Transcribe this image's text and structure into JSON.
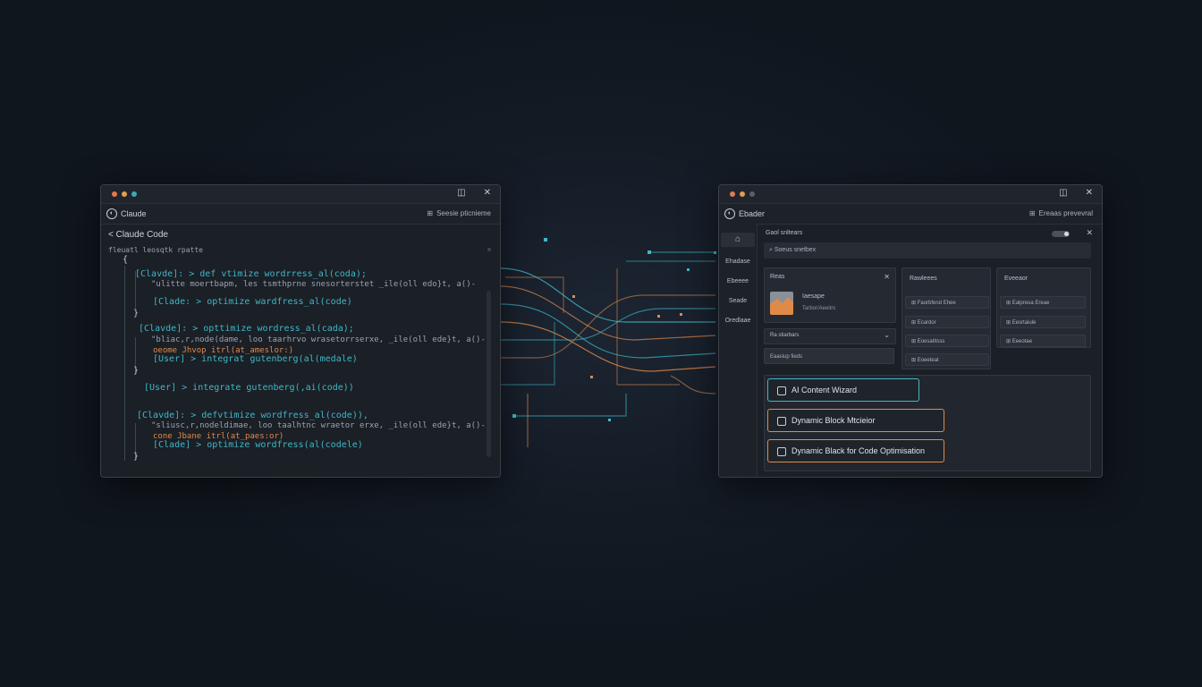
{
  "colors": {
    "teal": "#3fb8c8",
    "orange": "#e08a4a",
    "green": "#7fc7a8",
    "text": "#c8ced8",
    "dot_red": "#e07b4f",
    "dot_orange": "#e0a04f",
    "dot_teal": "#3fa8b8",
    "dot_gray": "#5a606a"
  },
  "left_window": {
    "title": "Claude",
    "header_action": "Seesie pticnieme",
    "breadcrumb": "< Claude Code",
    "file_label": "fleuatl leosqtk rpatte",
    "code_lines": [
      {
        "text": "{",
        "color": "#c8ced8"
      },
      {
        "text": "[Clavde]: > def vtimize wordrress_al(coda);",
        "color": "#3fb8c8"
      },
      {
        "text": "\"ulitte moertbapm, les tsmthprne snesorterstet _ile(oll edo}t, a()-",
        "color": "#9aa3b0"
      },
      {
        "text": "[Clade: > optimize wardfress_al(code)",
        "color": "#3fb8c8"
      },
      {
        "text": "}",
        "color": "#c8ced8"
      },
      {
        "text": "[Clavde]: > opttimize wordress_al(cada);",
        "color": "#3fb8c8"
      },
      {
        "text": "\"bliac,r,node(dame, loo taarhrvo wrasetorrserxe, _ile(oll ede}t, a()-",
        "color": "#9aa3b0"
      },
      {
        "text": "oeome Jhvop itrl(at_ameslor:)",
        "color": "#e08a4a"
      },
      {
        "text": "[User] > integrat gutenberg(al(medale)",
        "color": "#3fb8c8"
      },
      {
        "text": "}",
        "color": "#c8ced8"
      },
      {
        "text": "[User] > integrate gutenberg(,ai(code))",
        "color": "#3fb8c8"
      },
      {
        "text": "[Clavde]: > defvtimize wordfress_al(code)),",
        "color": "#3fb8c8"
      },
      {
        "text": "\"sliusc,r,nodeldimae, loo taalhtnc wraetor erxe, _ile(oll ede}t, a()-",
        "color": "#9aa3b0"
      },
      {
        "text": "cone Jbane itrl(at_paes:or)",
        "color": "#e08a4a"
      },
      {
        "text": "[Clade] > optimize wordfress(al(codele)",
        "color": "#3fb8c8"
      },
      {
        "text": "}",
        "color": "#c8ced8"
      }
    ]
  },
  "right_window": {
    "title": "Ebader",
    "header_action": "Ereaas prevevral",
    "sidebar": [
      "Ehadase",
      "Ebeeee",
      "Seade",
      "Oredlaae"
    ],
    "panel_title": "Gaol snltears",
    "search_placeholder": "Soeus snetbex",
    "box1": {
      "title": "Reas",
      "item_title": "Iaesape",
      "item_sub": "Tarbor/Aeeitrs"
    },
    "box2": {
      "title": "Ra stiarbars"
    },
    "box2_item": "Eaasiup fieds",
    "col2": {
      "title": "Rawleees",
      "items": [
        "Faorbfend Ehee",
        "Ecardor",
        "Eoesatitsss",
        "Eoeeteat"
      ]
    },
    "col3": {
      "title": "Eveeaor",
      "items": [
        "Ealpreoa Ereae",
        "Eesrtaiule",
        "Eeeotae"
      ]
    },
    "ai_buttons": [
      {
        "label": "AI Content Wizard",
        "color": "#3fb8c8"
      },
      {
        "label": "Dynamic Block Mtcieior",
        "color": "#e08a4a"
      },
      {
        "label": "Dynamic Black for Code Optimisation",
        "color": "#e08a4a"
      }
    ]
  }
}
